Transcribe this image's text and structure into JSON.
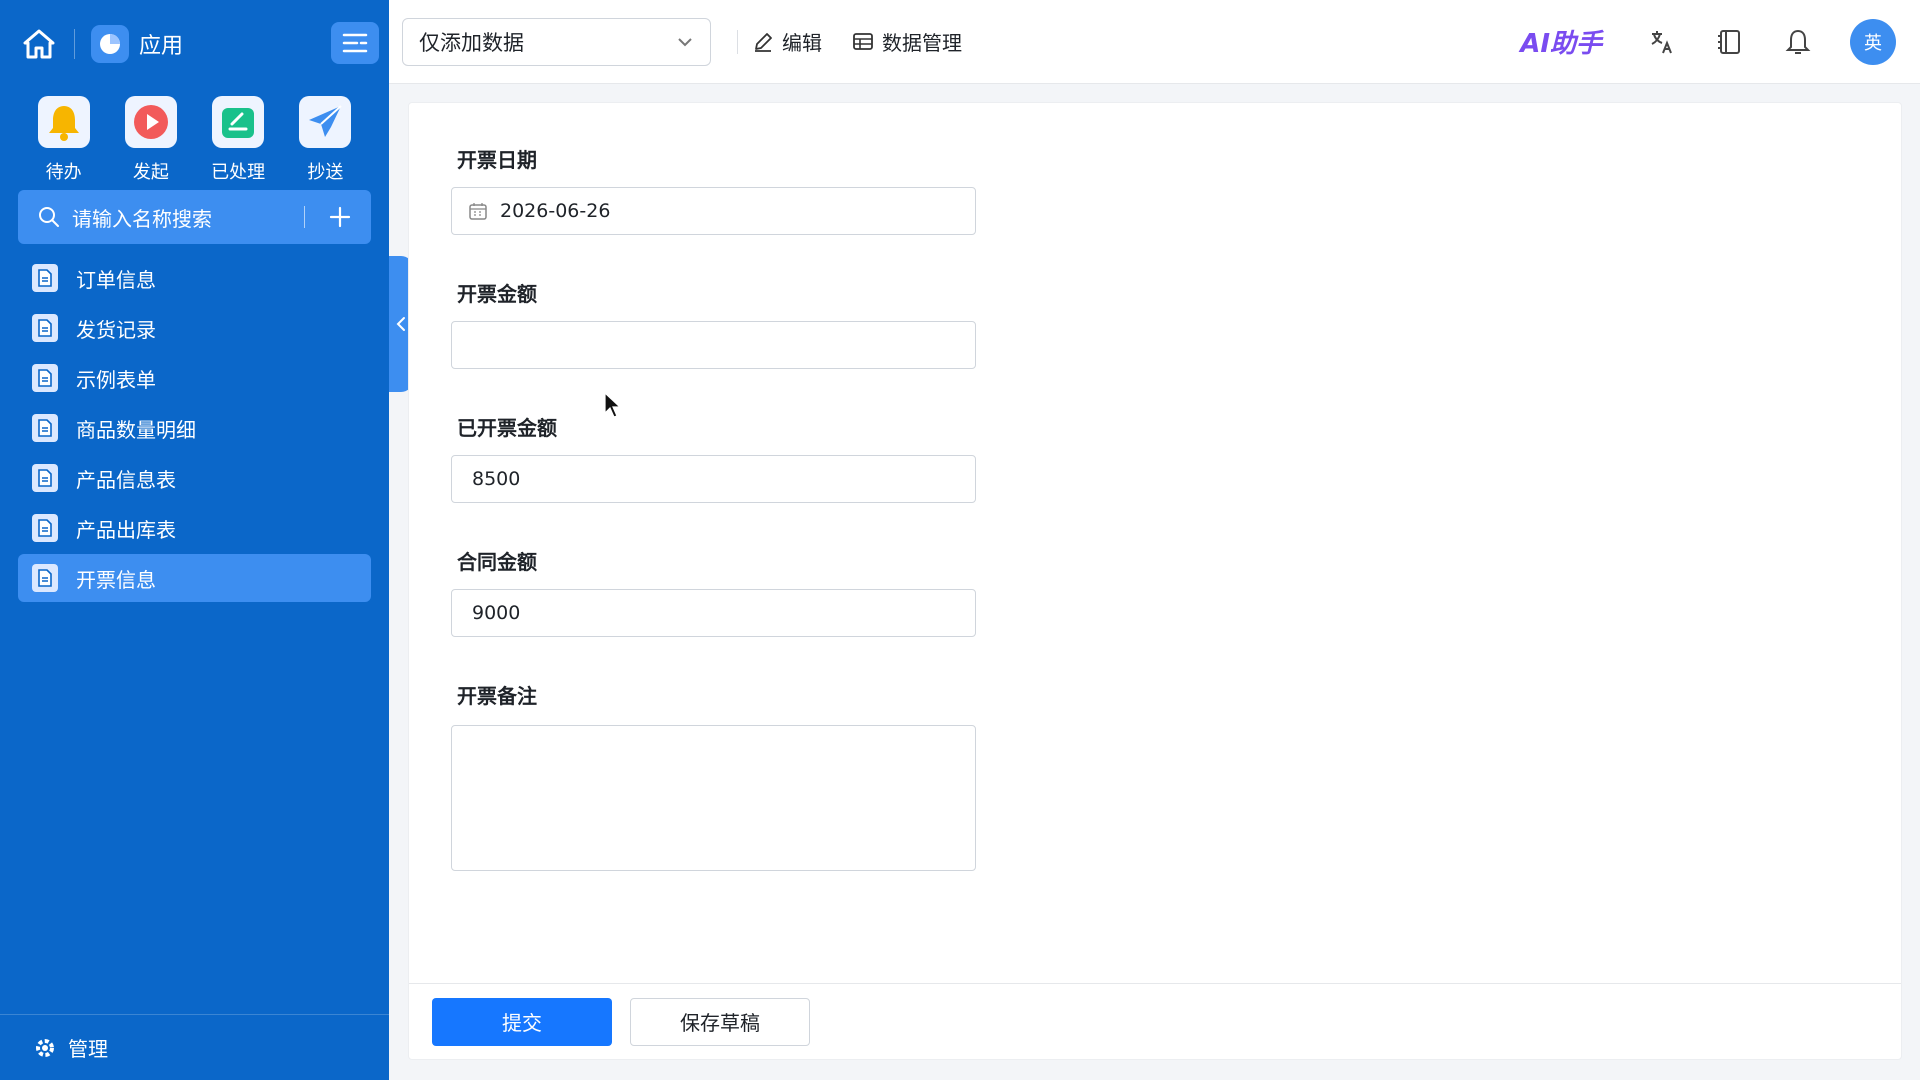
{
  "sidebar": {
    "app_name": "应用",
    "quick_actions": [
      {
        "label": "待办",
        "icon": "bell-icon"
      },
      {
        "label": "发起",
        "icon": "play-icon"
      },
      {
        "label": "已处理",
        "icon": "edit-icon"
      },
      {
        "label": "抄送",
        "icon": "send-icon"
      }
    ],
    "search_placeholder": "请输入名称搜索",
    "items": [
      {
        "label": "订单信息"
      },
      {
        "label": "发货记录"
      },
      {
        "label": "示例表单"
      },
      {
        "label": "商品数量明细"
      },
      {
        "label": "产品信息表"
      },
      {
        "label": "产品出库表"
      },
      {
        "label": "开票信息"
      }
    ],
    "active_index": 6,
    "bottom_label": "管理"
  },
  "topbar": {
    "select_value": "仅添加数据",
    "edit_label": "编辑",
    "data_manage_label": "数据管理",
    "ai_label": "AI助手",
    "avatar_text": "英"
  },
  "form": {
    "fields": [
      {
        "label": "开票日期",
        "value": "2026-06-26"
      },
      {
        "label": "开票金额",
        "value": ""
      },
      {
        "label": "已开票金额",
        "value": "8500"
      },
      {
        "label": "合同金额",
        "value": "9000"
      },
      {
        "label": "开票备注",
        "value": ""
      }
    ],
    "submit_label": "提交",
    "draft_label": "保存草稿"
  },
  "colors": {
    "sidebar_bg": "#0b67c9",
    "sidebar_highlight": "#3d8ef0",
    "primary_button": "#1677ff",
    "ai_text": "#7a4cf0"
  }
}
